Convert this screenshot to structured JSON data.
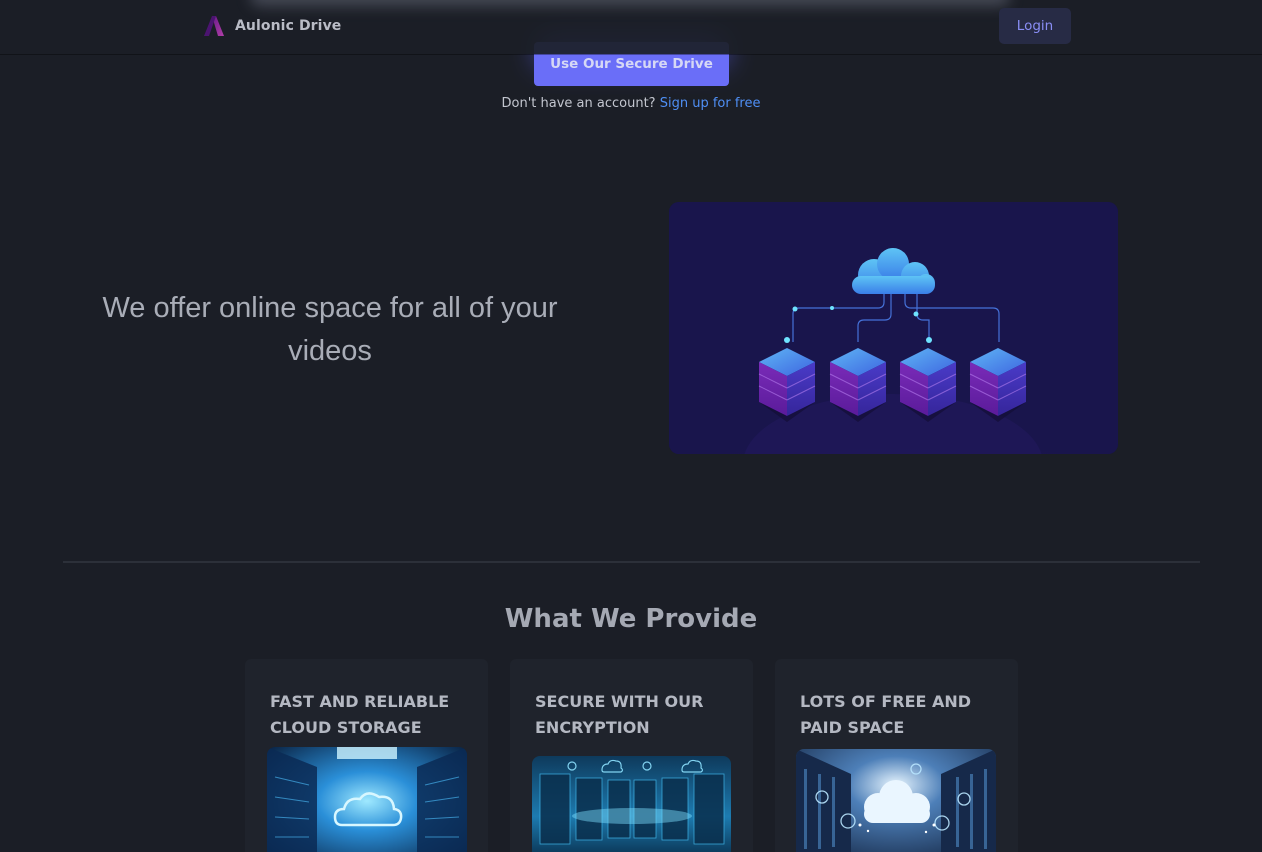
{
  "navbar": {
    "brand_name": "Aulonic Drive",
    "login_label": "Login"
  },
  "hero": {
    "cta_label": "Use Our Secure Drive",
    "signup_prompt": "Don't have an account?",
    "signup_link": "Sign up for free"
  },
  "offer": {
    "text": "We offer online space for all of your videos"
  },
  "provide": {
    "title": "What We Provide",
    "cards": [
      {
        "title": "FAST AND RELIABLE CLOUD STORAGE"
      },
      {
        "title": "SECURE WITH OUR ENCRYPTION"
      },
      {
        "title": "LOTS OF FREE AND PAID SPACE"
      }
    ]
  },
  "colors": {
    "background": "#1b1e26",
    "accent": "#6a6ef8",
    "link": "#4f8ff5",
    "card": "#1f232c"
  }
}
